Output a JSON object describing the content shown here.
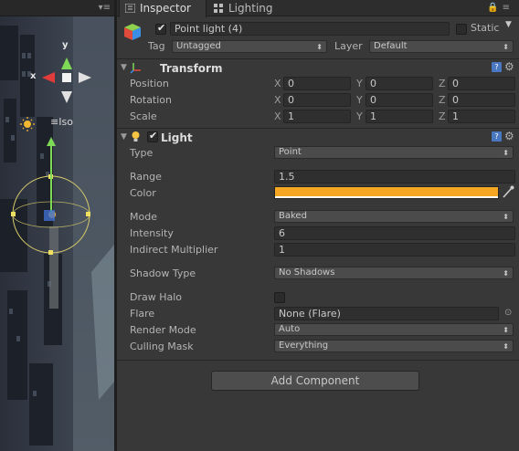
{
  "tabs": [
    {
      "label": "Inspector"
    },
    {
      "label": "Lighting"
    }
  ],
  "scene": {
    "view_mode": "Iso",
    "axis_y": "y",
    "axis_x": "x"
  },
  "gameobject": {
    "name": "Point light (4)",
    "active": true,
    "static_label": "Static",
    "tag_label": "Tag",
    "tag_value": "Untagged",
    "layer_label": "Layer",
    "layer_value": "Default"
  },
  "transform": {
    "title": "Transform",
    "position_label": "Position",
    "rotation_label": "Rotation",
    "scale_label": "Scale",
    "axes": [
      "X",
      "Y",
      "Z"
    ],
    "position": [
      "0",
      "0",
      "0"
    ],
    "rotation": [
      "0",
      "0",
      "0"
    ],
    "scale": [
      "1",
      "1",
      "1"
    ]
  },
  "light": {
    "title": "Light",
    "enabled": true,
    "type_label": "Type",
    "type_value": "Point",
    "range_label": "Range",
    "range_value": "1.5",
    "color_label": "Color",
    "color_value": "#f5a623",
    "mode_label": "Mode",
    "mode_value": "Baked",
    "intensity_label": "Intensity",
    "intensity_value": "6",
    "indirect_label": "Indirect Multiplier",
    "indirect_value": "1",
    "shadow_label": "Shadow Type",
    "shadow_value": "No Shadows",
    "halo_label": "Draw Halo",
    "flare_label": "Flare",
    "flare_value": "None (Flare)",
    "render_mode_label": "Render Mode",
    "render_mode_value": "Auto",
    "culling_label": "Culling Mask",
    "culling_value": "Everything"
  },
  "add_component_label": "Add Component",
  "colors": {
    "panel_bg": "#383838",
    "light_color": "#f5a623",
    "help_icon": "#4a78c0"
  }
}
